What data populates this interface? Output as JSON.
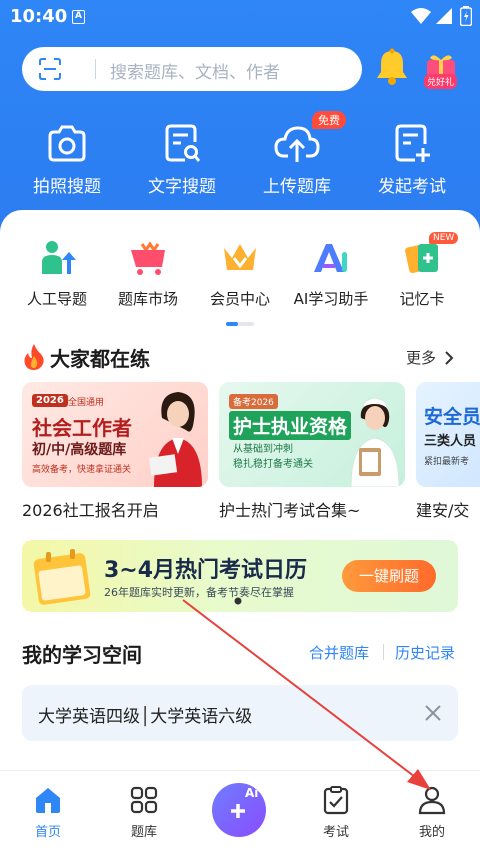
{
  "status_bar": {
    "time": "10:40",
    "notif_letter": "A"
  },
  "search": {
    "placeholder": "搜索题库、文档、作者"
  },
  "gift": {
    "label": "兑好礼"
  },
  "features": [
    {
      "label": "拍照搜题",
      "icon": "camera-icon"
    },
    {
      "label": "文字搜题",
      "icon": "text-search-icon"
    },
    {
      "label": "上传题库",
      "icon": "cloud-upload-icon",
      "badge": "免费"
    },
    {
      "label": "发起考试",
      "icon": "create-exam-icon"
    }
  ],
  "tools": [
    {
      "label": "人工导题",
      "icon": "manual-import-icon"
    },
    {
      "label": "题库市场",
      "icon": "market-cart-icon"
    },
    {
      "label": "会员中心",
      "icon": "crown-icon"
    },
    {
      "label": "AI学习助手",
      "icon": "ai-assistant-icon"
    },
    {
      "label": "记忆卡",
      "icon": "memory-card-icon",
      "badge": "NEW"
    }
  ],
  "popular": {
    "title": "大家都在练",
    "more": "更多",
    "banners": [
      {
        "year_tag": "2026",
        "general_tag": "全国通用",
        "title": "社会工作者",
        "sub": "初/中/高级题库",
        "note": "高效备考，快速拿证通关",
        "caption": "2026社工报名开启"
      },
      {
        "tag": "备考2026",
        "title": "护士执业资格",
        "points": [
          "从基础到冲刺",
          "稳扎稳打备考通关"
        ],
        "caption": "护士热门考试合集~"
      },
      {
        "title": "安全员",
        "sub": "三类人员",
        "note": "紧扣最新考",
        "caption": "建安/交"
      }
    ]
  },
  "promo": {
    "title": "3~4月热门考试日历",
    "subtitle": "26年题库实时更新，备考节奏尽在掌握",
    "button": "一键刷题"
  },
  "study_space": {
    "title": "我的学习空间",
    "merge": "合并题库",
    "history": "历史记录",
    "recent": "大学英语四级│大学英语六级"
  },
  "nav": [
    {
      "label": "首页",
      "active": true
    },
    {
      "label": "题库",
      "active": false
    },
    {
      "label": "考试",
      "active": false
    },
    {
      "label": "我的",
      "active": false
    }
  ],
  "nav_center_badge": "Ai",
  "colors": {
    "primary": "#2f86f6",
    "accent_orange": "#ff6a2a",
    "annotation_red": "#e8403a"
  }
}
